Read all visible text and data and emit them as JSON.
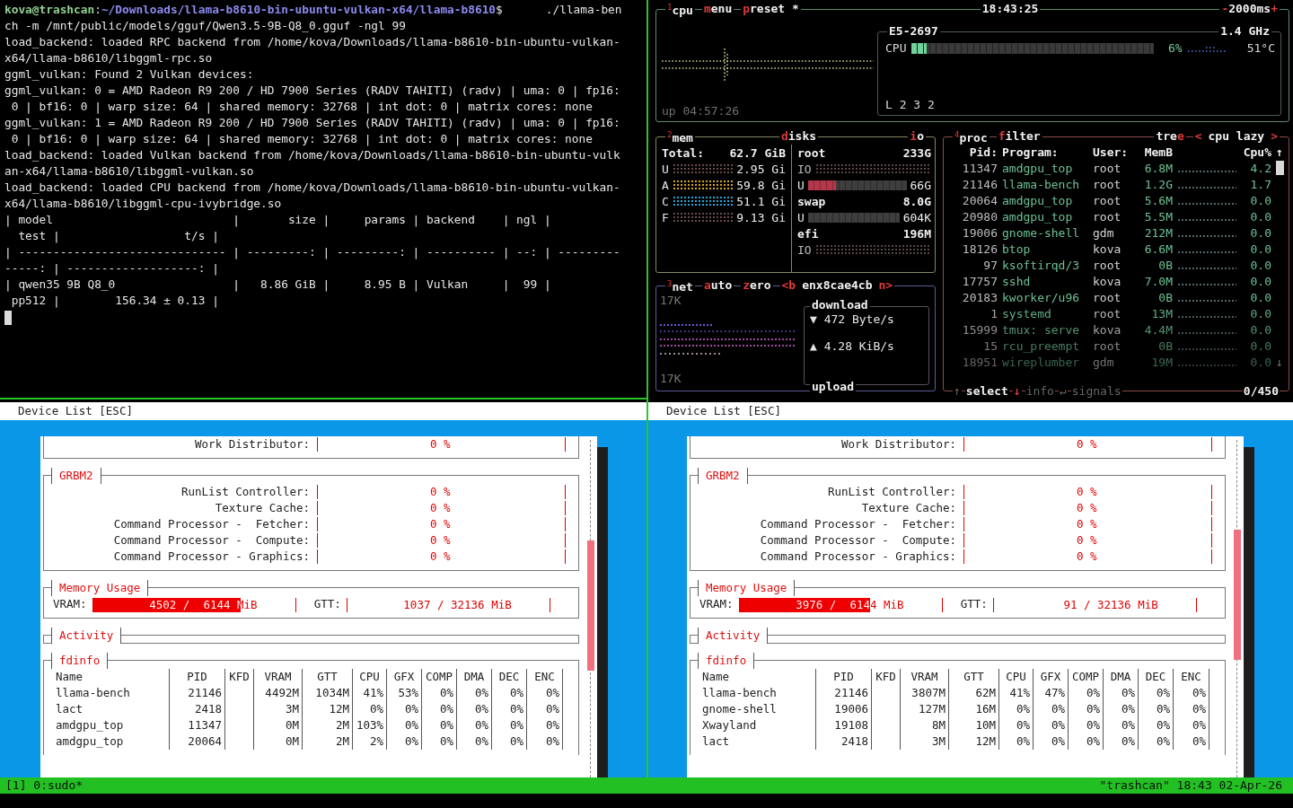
{
  "terminal": {
    "prompt": [
      {
        "text": "kova@trashcan",
        "kind": "user"
      },
      {
        "text": ":",
        "kind": "plain"
      },
      {
        "text": "~/Downloads/llama-b8610-bin-ubuntu-vulkan-x64/llama-b8610",
        "kind": "path"
      },
      {
        "text": "$",
        "kind": "plain"
      },
      {
        "text": "./llama-ben",
        "kind": "command"
      }
    ],
    "lines": [
      "ch -m /mnt/public/models/gguf/Qwen3.5-9B-Q8_0.gguf -ngl 99",
      "load_backend: loaded RPC backend from /home/kova/Downloads/llama-b8610-bin-ubuntu-vulkan-",
      "x64/llama-b8610/libggml-rpc.so",
      "ggml_vulkan: Found 2 Vulkan devices:",
      "ggml_vulkan: 0 = AMD Radeon R9 200 / HD 7900 Series (RADV TAHITI) (radv) | uma: 0 | fp16:",
      " 0 | bf16: 0 | warp size: 64 | shared memory: 32768 | int dot: 0 | matrix cores: none",
      "ggml_vulkan: 1 = AMD Radeon R9 200 / HD 7900 Series (RADV TAHITI) (radv) | uma: 0 | fp16:",
      " 0 | bf16: 0 | warp size: 64 | shared memory: 32768 | int dot: 0 | matrix cores: none",
      "load_backend: loaded Vulkan backend from /home/kova/Downloads/llama-b8610-bin-ubuntu-vulk",
      "an-x64/llama-b8610/libggml-vulkan.so",
      "load_backend: loaded CPU backend from /home/kova/Downloads/llama-b8610-bin-ubuntu-vulkan-",
      "x64/llama-b8610/libggml-cpu-ivybridge.so",
      "| model                          |       size |     params | backend    | ngl |",
      "  test |                  t/s |",
      "| ------------------------------ | ---------: | ---------: | ---------- | --: | ---------",
      "-----: | -------------------: |",
      "| qwen35 9B Q8_0                 |   8.86 GiB |     8.95 B | Vulkan     |  99 |",
      " pp512 |        156.34 ± 0.13 |"
    ],
    "cursor": true
  },
  "btop": {
    "cpu": {
      "tabs": [
        [
          {
            "text": "1",
            "kind": "sup"
          },
          {
            "text": "cpu",
            "kind": "label"
          }
        ],
        [
          {
            "text": "m",
            "kind": "hot"
          },
          {
            "text": "enu",
            "kind": "label"
          }
        ],
        [
          {
            "text": "p",
            "kind": "hot"
          },
          {
            "text": "reset *",
            "kind": "label"
          }
        ]
      ],
      "clock": [
        {
          "text": "18:43:25",
          "kind": "label"
        }
      ],
      "interval": [
        {
          "text": "-",
          "kind": "hot"
        },
        {
          "text": "2000ms",
          "kind": "label"
        },
        {
          "text": "+",
          "kind": "hot"
        }
      ],
      "uptime": "up 04:57:26",
      "model": "E5-2697",
      "freq": "1.4 GHz",
      "label": "CPU",
      "level": 0.06,
      "percent": "6%",
      "temp": "51°C",
      "load": "L 2 3 2"
    },
    "mem": {
      "title": [
        {
          "text": "2",
          "kind": "sup"
        },
        {
          "text": "mem",
          "kind": "label"
        }
      ],
      "total_label": "Total:",
      "total": "62.7 GiB",
      "rows": [
        {
          "label": "U",
          "value": "2.95 Gi",
          "color": "#6b4a4a"
        },
        {
          "label": "A",
          "value": "59.8 Gi",
          "color": "#d9a521"
        },
        {
          "label": "C",
          "value": "51.1 Gi",
          "color": "#2aa4d6"
        },
        {
          "label": "F",
          "value": "9.13 Gi",
          "color": "#6b4a4a"
        }
      ]
    },
    "disks": {
      "title": [
        {
          "text": "d",
          "kind": "hot"
        },
        {
          "text": "isks",
          "kind": "label"
        }
      ],
      "io_title": [
        {
          "text": "i",
          "kind": "hot"
        },
        {
          "text": "o",
          "kind": "label"
        }
      ],
      "entries": [
        {
          "kind": "disk",
          "name": "root",
          "size": "233G"
        },
        {
          "kind": "io",
          "label": "IO"
        },
        {
          "kind": "usage",
          "label": "U",
          "level": 0.28,
          "value": "66G"
        },
        {
          "kind": "disk",
          "name": "swap",
          "size": "8.0G"
        },
        {
          "kind": "usage",
          "label": "U",
          "value": "604K"
        },
        {
          "kind": "disk",
          "name": "efi",
          "size": "196M"
        },
        {
          "kind": "io",
          "label": "IO"
        }
      ]
    },
    "net": {
      "title": [
        {
          "text": "3",
          "kind": "sup"
        },
        {
          "text": "net",
          "kind": "label"
        }
      ],
      "modes": [
        [
          {
            "text": "a",
            "kind": "hot"
          },
          {
            "text": "uto",
            "kind": "label"
          }
        ],
        [
          {
            "text": "z",
            "kind": "hot"
          },
          {
            "text": "ero",
            "kind": "label"
          }
        ]
      ],
      "interface": [
        {
          "text": "<b",
          "kind": "hot"
        },
        {
          "text": "enx8cae4cb",
          "kind": "label"
        },
        {
          "text": "n>",
          "kind": "hot"
        }
      ],
      "scale_top": "17K",
      "scale_bottom": "17K",
      "download_label": "download",
      "download": "▼ 472 Byte/s",
      "upload": "▲ 4.28 KiB/s",
      "upload_label": "upload"
    },
    "proc": {
      "title": [
        {
          "text": "4",
          "kind": "sup"
        },
        {
          "text": "proc",
          "kind": "label"
        }
      ],
      "filter": [
        {
          "text": "f",
          "kind": "hot"
        },
        {
          "text": "ilter",
          "kind": "label"
        }
      ],
      "tree": [
        {
          "text": "tre",
          "kind": "label"
        },
        {
          "text": "e",
          "kind": "hot"
        }
      ],
      "sort": [
        {
          "text": "<",
          "kind": "hot"
        },
        {
          "text": "cpu lazy",
          "kind": "label"
        },
        {
          "text": ">",
          "kind": "hot"
        }
      ],
      "columns": [
        "Pid:",
        "Program:",
        "User:",
        "MemB",
        "Cpu%"
      ],
      "sort_arrow": "↑",
      "rows": [
        {
          "pid": "11347",
          "program": "amdgpu_top",
          "user": "root",
          "mem": "6.8M",
          "cpu": "4.2"
        },
        {
          "pid": "21146",
          "program": "llama-bench",
          "user": "root",
          "mem": "1.2G",
          "cpu": "1.7"
        },
        {
          "pid": "20064",
          "program": "amdgpu_top",
          "user": "root",
          "mem": "5.6M",
          "cpu": "0.0"
        },
        {
          "pid": "20980",
          "program": "amdgpu_top",
          "user": "root",
          "mem": "5.5M",
          "cpu": "0.0"
        },
        {
          "pid": "19006",
          "program": "gnome-shell",
          "user": "gdm",
          "mem": "212M",
          "cpu": "0.0"
        },
        {
          "pid": "18126",
          "program": "btop",
          "user": "kova",
          "mem": "6.6M",
          "cpu": "0.0"
        },
        {
          "pid": "97",
          "program": "ksoftirqd/3",
          "user": "root",
          "mem": "0B",
          "cpu": "0.0"
        },
        {
          "pid": "17757",
          "program": "sshd",
          "user": "kova",
          "mem": "7.0M",
          "cpu": "0.0"
        },
        {
          "pid": "20183",
          "program": "kworker/u96",
          "user": "root",
          "mem": "0B",
          "cpu": "0.0"
        },
        {
          "pid": "1",
          "program": "systemd",
          "user": "root",
          "mem": "13M",
          "cpu": "0.0"
        },
        {
          "pid": "15999",
          "program": "tmux: serve",
          "user": "kova",
          "mem": "4.4M",
          "cpu": "0.0"
        },
        {
          "pid": "15",
          "program": "rcu_preempt",
          "user": "root",
          "mem": "0B",
          "cpu": "0.0"
        },
        {
          "pid": "18951",
          "program": "wireplumber",
          "user": "gdm",
          "mem": "19M",
          "cpu": "0.0"
        }
      ],
      "scroll_down": "↓",
      "footer": {
        "up": "↑",
        "select": "select",
        "down": "↓",
        "info": "info",
        "enter": "↵",
        "signals": "signals",
        "count": "0/450"
      }
    }
  },
  "gpu_panes": [
    {
      "header": "Device List [ESC]",
      "top_rows": [
        {
          "label": "Work Distributor:",
          "value": "0 %"
        }
      ],
      "grbm2": {
        "title": "GRBM2",
        "rows": [
          {
            "label": "RunList Controller:",
            "value": "0 %"
          },
          {
            "label": "Texture Cache:",
            "value": "0 %"
          },
          {
            "label": "Command Processor -  Fetcher:",
            "value": "0 %"
          },
          {
            "label": "Command Processor -  Compute:",
            "value": "0 %"
          },
          {
            "label": "Command Processor - Graphics:",
            "value": "0 %"
          }
        ]
      },
      "memory": {
        "title": "Memory Usage",
        "rows": [
          {
            "label": "VRAM:",
            "value": "4502 /  6144 MiB",
            "level": 0.73
          },
          {
            "label": "GTT:",
            "value": "1037 / 32136 MiB"
          }
        ]
      },
      "activity": {
        "title": "Activity"
      },
      "fdinfo": {
        "title": "fdinfo",
        "columns": [
          "Name",
          "PID",
          "KFD",
          "VRAM",
          "GTT",
          "CPU",
          "GFX",
          "COMP",
          "DMA",
          "DEC",
          "ENC"
        ],
        "rows": [
          {
            "name": "llama-bench",
            "pid": "21146",
            "vram": "4492M",
            "gtt": "1034M",
            "cpu": "41%",
            "gfx": "53%",
            "comp": "0%",
            "dma": "0%",
            "dec": "0%",
            "enc": "0%"
          },
          {
            "name": "lact",
            "pid": "2418",
            "vram": "3M",
            "gtt": "12M",
            "cpu": "0%",
            "gfx": "0%",
            "comp": "0%",
            "dma": "0%",
            "dec": "0%",
            "enc": "0%"
          },
          {
            "name": "amdgpu_top",
            "pid": "11347",
            "vram": "0M",
            "gtt": "2M",
            "cpu": "103%",
            "gfx": "0%",
            "comp": "0%",
            "dma": "0%",
            "dec": "0%",
            "enc": "0%"
          },
          {
            "name": "amdgpu_top",
            "pid": "20064",
            "vram": "0M",
            "gtt": "2M",
            "cpu": "2%",
            "gfx": "0%",
            "comp": "0%",
            "dma": "0%",
            "dec": "0%",
            "enc": "0%"
          }
        ]
      }
    },
    {
      "header": "Device List [ESC]",
      "top_rows": [
        {
          "label": "Work Distributor:",
          "value": "0 %"
        }
      ],
      "grbm2": {
        "title": "GRBM2",
        "rows": [
          {
            "label": "RunList Controller:",
            "value": "0 %"
          },
          {
            "label": "Texture Cache:",
            "value": "0 %"
          },
          {
            "label": "Command Processor -  Fetcher:",
            "value": "0 %"
          },
          {
            "label": "Command Processor -  Compute:",
            "value": "0 %"
          },
          {
            "label": "Command Processor - Graphics:",
            "value": "0 %"
          }
        ]
      },
      "memory": {
        "title": "Memory Usage",
        "rows": [
          {
            "label": "VRAM:",
            "value": "3976 /  6144 MiB",
            "level": 0.647
          },
          {
            "label": "GTT:",
            "value": "91 / 32136 MiB"
          }
        ]
      },
      "activity": {
        "title": "Activity"
      },
      "fdinfo": {
        "title": "fdinfo",
        "columns": [
          "Name",
          "PID",
          "KFD",
          "VRAM",
          "GTT",
          "CPU",
          "GFX",
          "COMP",
          "DMA",
          "DEC",
          "ENC"
        ],
        "rows": [
          {
            "name": "llama-bench",
            "pid": "21146",
            "vram": "3807M",
            "gtt": "62M",
            "cpu": "41%",
            "gfx": "47%",
            "comp": "0%",
            "dma": "0%",
            "dec": "0%",
            "enc": "0%"
          },
          {
            "name": "gnome-shell",
            "pid": "19006",
            "vram": "127M",
            "gtt": "16M",
            "cpu": "0%",
            "gfx": "0%",
            "comp": "0%",
            "dma": "0%",
            "dec": "0%",
            "enc": "0%"
          },
          {
            "name": "Xwayland",
            "pid": "19108",
            "vram": "8M",
            "gtt": "10M",
            "cpu": "0%",
            "gfx": "0%",
            "comp": "0%",
            "dma": "0%",
            "dec": "0%",
            "enc": "0%"
          },
          {
            "name": "lact",
            "pid": "2418",
            "vram": "3M",
            "gtt": "12M",
            "cpu": "0%",
            "gfx": "0%",
            "comp": "0%",
            "dma": "0%",
            "dec": "0%",
            "enc": "0%"
          }
        ]
      }
    }
  ],
  "status_bar": {
    "session": "[1] 0:sudo*",
    "host_time": "\"trashcan\" 18:43 02-Apr-26"
  }
}
